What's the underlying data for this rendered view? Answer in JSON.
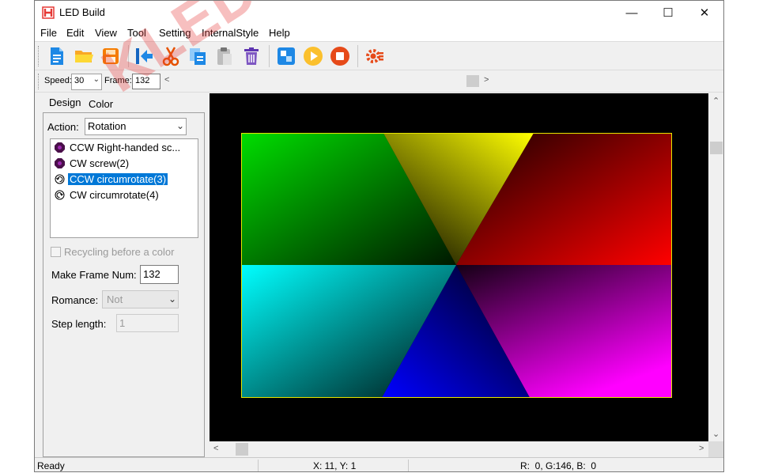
{
  "window": {
    "title": "LED Build",
    "minimize": "—",
    "maximize": "☐",
    "close": "✕"
  },
  "menu": [
    "File",
    "Edit",
    "View",
    "Tool",
    "Setting",
    "InternalStyle",
    "Help"
  ],
  "toolbar_icons": [
    "new-file-icon",
    "open-folder-icon",
    "save-icon",
    "go-start-icon",
    "cut-icon",
    "copy-icon",
    "paste-icon",
    "delete-icon",
    "layout-icon",
    "play-icon",
    "stop-icon",
    "settings-gear-icon"
  ],
  "speed_bar": {
    "speed_label": "Speed:",
    "speed_value": "30",
    "frame_label": "Frame:",
    "frame_value": "132",
    "left_arrow": "<",
    "right_arrow": ">"
  },
  "tabs": [
    "Design",
    "Color"
  ],
  "design": {
    "action_label": "Action:",
    "action_value": "Rotation",
    "effects": [
      {
        "label": "CCW Right-handed sc...",
        "icon": "screw-icon",
        "selected": false
      },
      {
        "label": "CW screw(2)",
        "icon": "screw-icon",
        "selected": false
      },
      {
        "label": "CCW circumrotate(3)",
        "icon": "rotate-ccw-icon",
        "selected": true
      },
      {
        "label": "CW circumrotate(4)",
        "icon": "rotate-cw-icon",
        "selected": false
      }
    ],
    "recycling_label": "Recycling before a color",
    "make_frame_label": "Make Frame Num:",
    "make_frame_value": "132",
    "romance_label": "Romance:",
    "romance_value": "Not",
    "step_label": "Step length:",
    "step_value": "1"
  },
  "status": {
    "ready": "Ready",
    "coords": "X: 11, Y: 1",
    "rgb": "R:  0, G:146, B:  0"
  },
  "watermark": "KLED",
  "colors": {
    "accent": "#0078d7",
    "led_border": "#e6e600",
    "canvas_bg": "#000000"
  }
}
